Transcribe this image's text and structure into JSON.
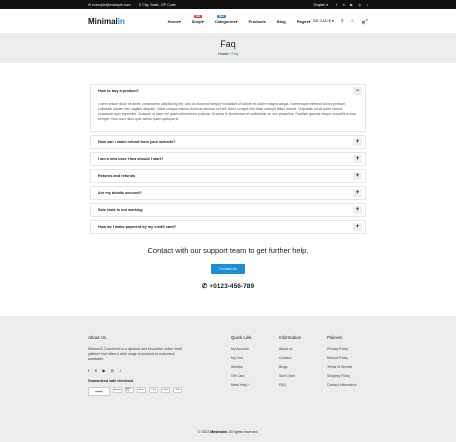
{
  "topbar": {
    "email": "example@example.com",
    "address": "City, State, ZIP Code",
    "language": "English",
    "social_icons": [
      "facebook-icon",
      "twitter-icon",
      "youtube-icon",
      "instagram-icon",
      "tiktok-icon"
    ]
  },
  "header": {
    "logo_main": "Minimal",
    "logo_accent": "in",
    "nav": [
      {
        "label": "Home",
        "caret": "▾"
      },
      {
        "label": "Shop",
        "caret": "▾",
        "badge": "Hot",
        "badge_color": "#e53935"
      },
      {
        "label": "Categories",
        "caret": "▾",
        "badge": "New",
        "badge_color": "#1a8dd6"
      },
      {
        "label": "Products",
        "caret": ""
      },
      {
        "label": "Blog",
        "caret": ""
      },
      {
        "label": "Pages",
        "caret": "▾"
      }
    ],
    "currency": "BD CAD $ ▾",
    "cart_count": "0"
  },
  "hero": {
    "title": "Faq",
    "crumb_home": "Home",
    "crumb_sep": "›",
    "crumb_current": "Faq"
  },
  "faq": {
    "open_answer": "Lorem ipsum dolor sit amet, consectetur adipisicing elit, sed do eiusmod tempor incididunt ut labore et dolore magna aliqua. Scelerisque eleifend donec pretium vulputate sapien nec sagittis aliquam. Vitae congue mauris rhoncus aenean vel elit. Nunc congue nisi vitae suscipit tellus mauris. Vulputate mi sit amet mauris commodo quis imperdiet. Quisque id diam vel quam elementum pulvinar. Gravida in fermentum et sollicitudin ac orci phasellus. Facilisis gravida neque convallis a cras semper. Non arcu risus quis varius quam quisque id.",
    "items": [
      {
        "question": "How to buy a product?",
        "toggle": "−"
      },
      {
        "question": "How can i make refund from your website?",
        "toggle": "+"
      },
      {
        "question": "I am a new user. How should I start?",
        "toggle": "+"
      },
      {
        "question": "Returns and refunds",
        "toggle": "+"
      },
      {
        "question": "Are my details secured?",
        "toggle": "+"
      },
      {
        "question": "Sale code is not working",
        "toggle": "+"
      },
      {
        "question": "How do I make payment by my credit card?",
        "toggle": "+"
      }
    ]
  },
  "support": {
    "heading": "Contact with our support team to get further help.",
    "button": "Contact Us",
    "phone": "+0123-456-789"
  },
  "footer": {
    "about_title": "About Us.",
    "about_text": "Minimal E-Commerce is a dynamic and innovative online retail platform that offers a wide range of products to customers worldwide.",
    "guaranteed": "Guaranteed safe checkout",
    "payments": [
      "shopify",
      "Amazon",
      "Apple Pay",
      "Bitcoin",
      "G Pay",
      "PayPal",
      "VISA"
    ],
    "quick_title": "Quick Link",
    "quick_links": [
      "My Account",
      "My Cart",
      "Wishlist",
      "Gift Card",
      "Need Help?"
    ],
    "info_title": "Information",
    "info_links": [
      "About us",
      "Contact",
      "Blogs",
      "Size Chart",
      "FAQ"
    ],
    "policies_title": "Policies",
    "policies_links": [
      "Privacy Policy",
      "Refund Policy",
      "Terms of Service",
      "Shipping Policy",
      "Contact Information"
    ],
    "copyright_pre": "© 2023",
    "copyright_brand": "Minimalin",
    "copyright_post": ". All rights reserved."
  }
}
